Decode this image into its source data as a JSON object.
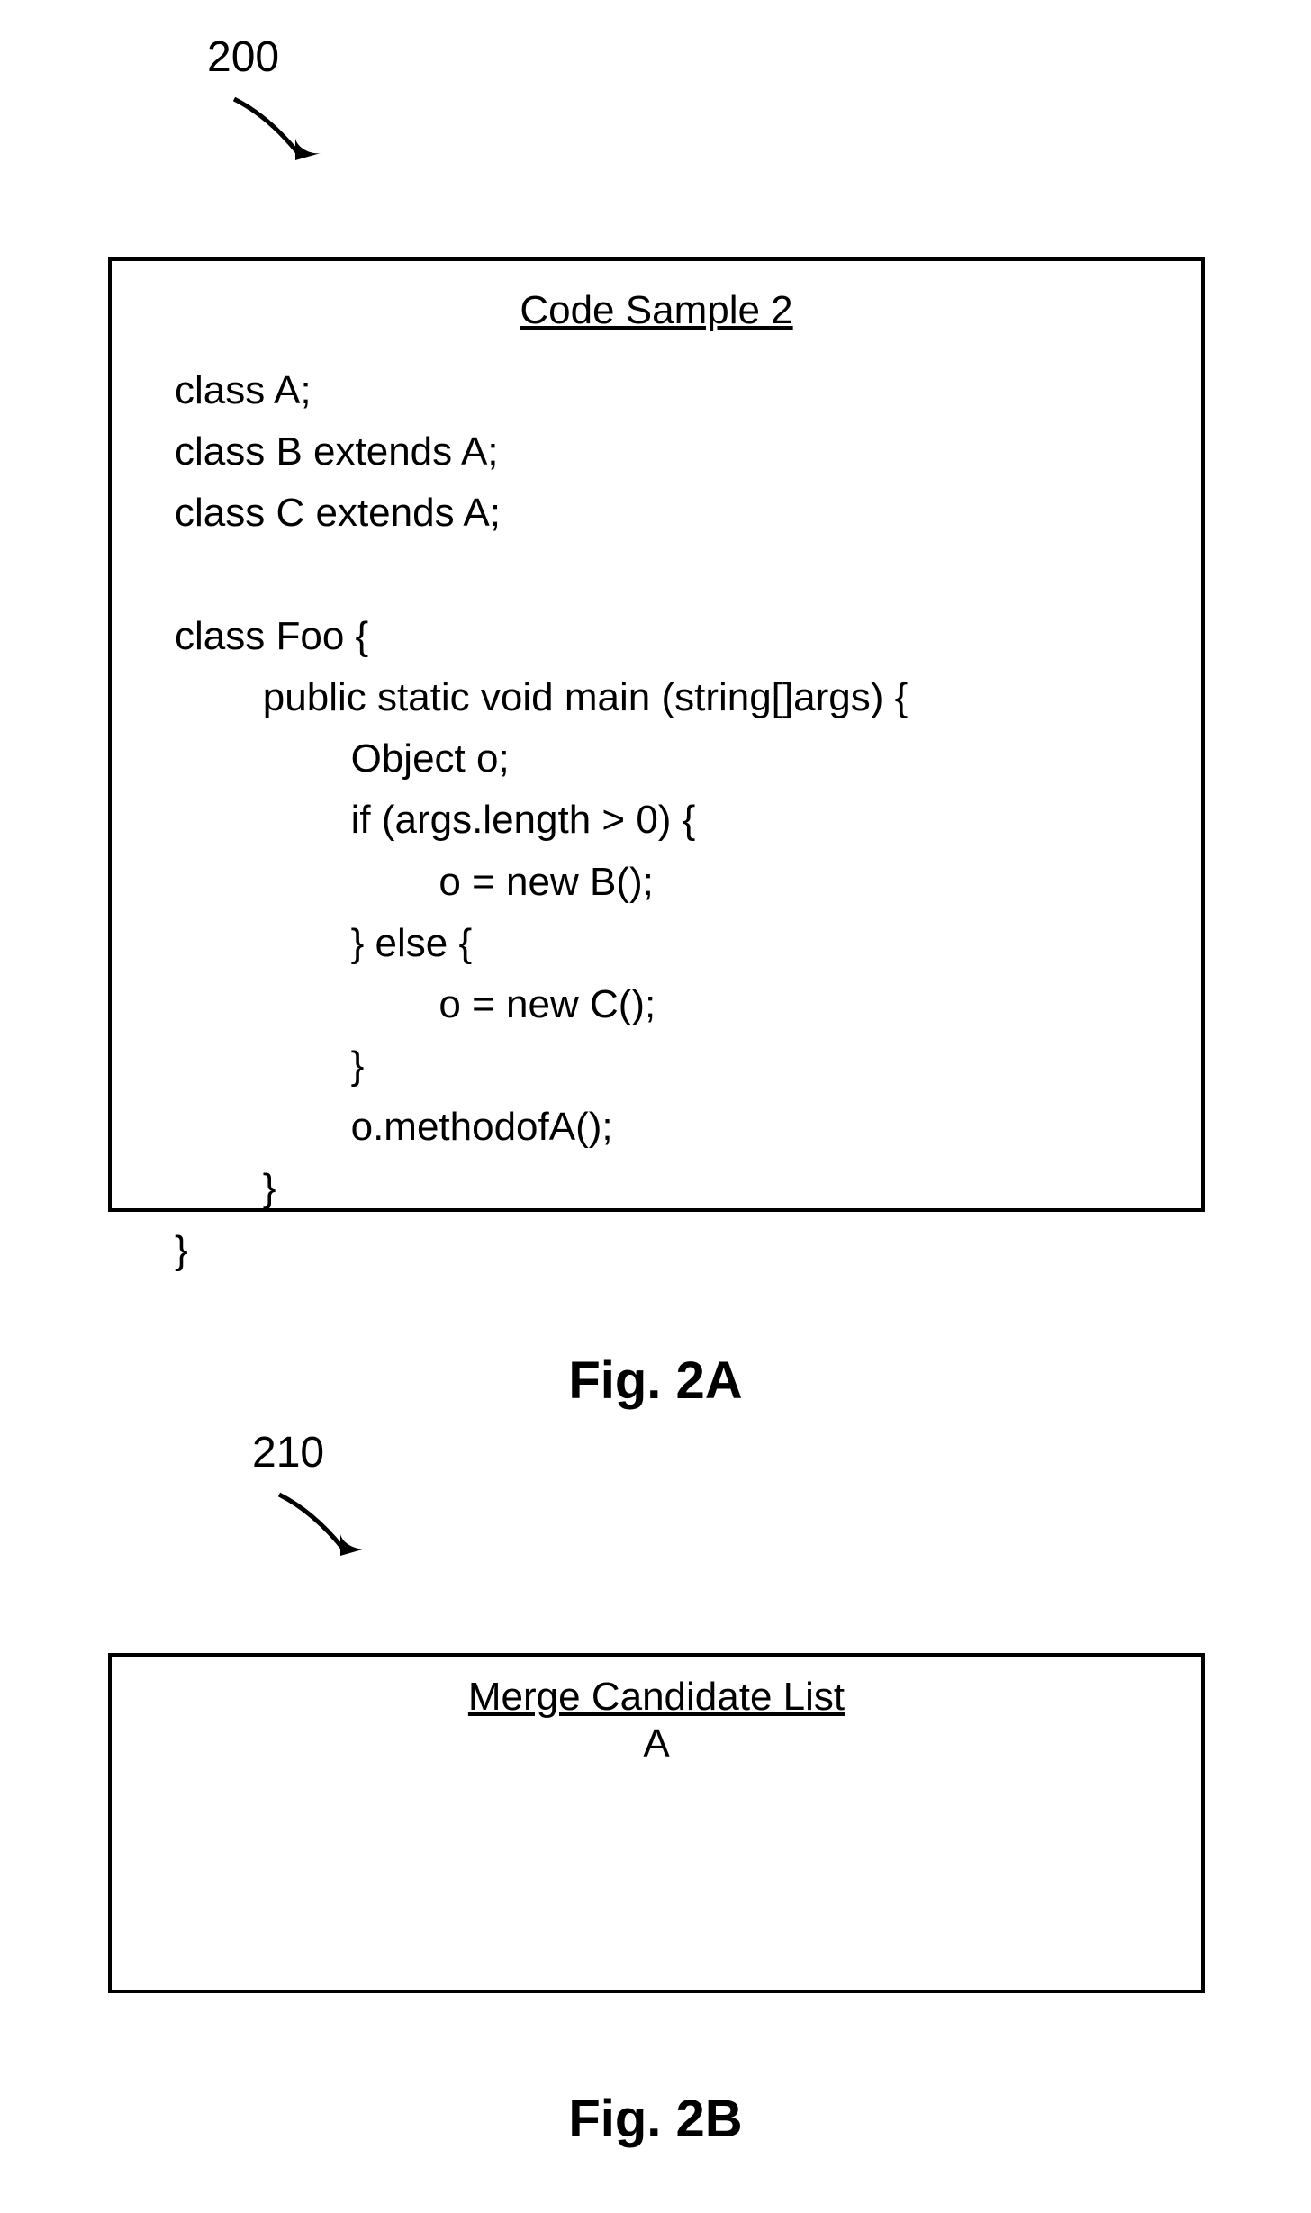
{
  "fig1": {
    "ref": "200",
    "box_title": "Code Sample 2",
    "code_lines": "class A;\nclass B extends A;\nclass C extends A;\n\nclass Foo {\n        public static void main (string[]args) {\n                Object o;\n                if (args.length > 0) {\n                        o = new B();\n                } else {\n                        o = new C();\n                }\n                o.methodofA();\n        }\n}",
    "caption": "Fig. 2A"
  },
  "fig2": {
    "ref": "210",
    "box_title": "Merge Candidate List",
    "content": "A",
    "caption": "Fig. 2B"
  }
}
